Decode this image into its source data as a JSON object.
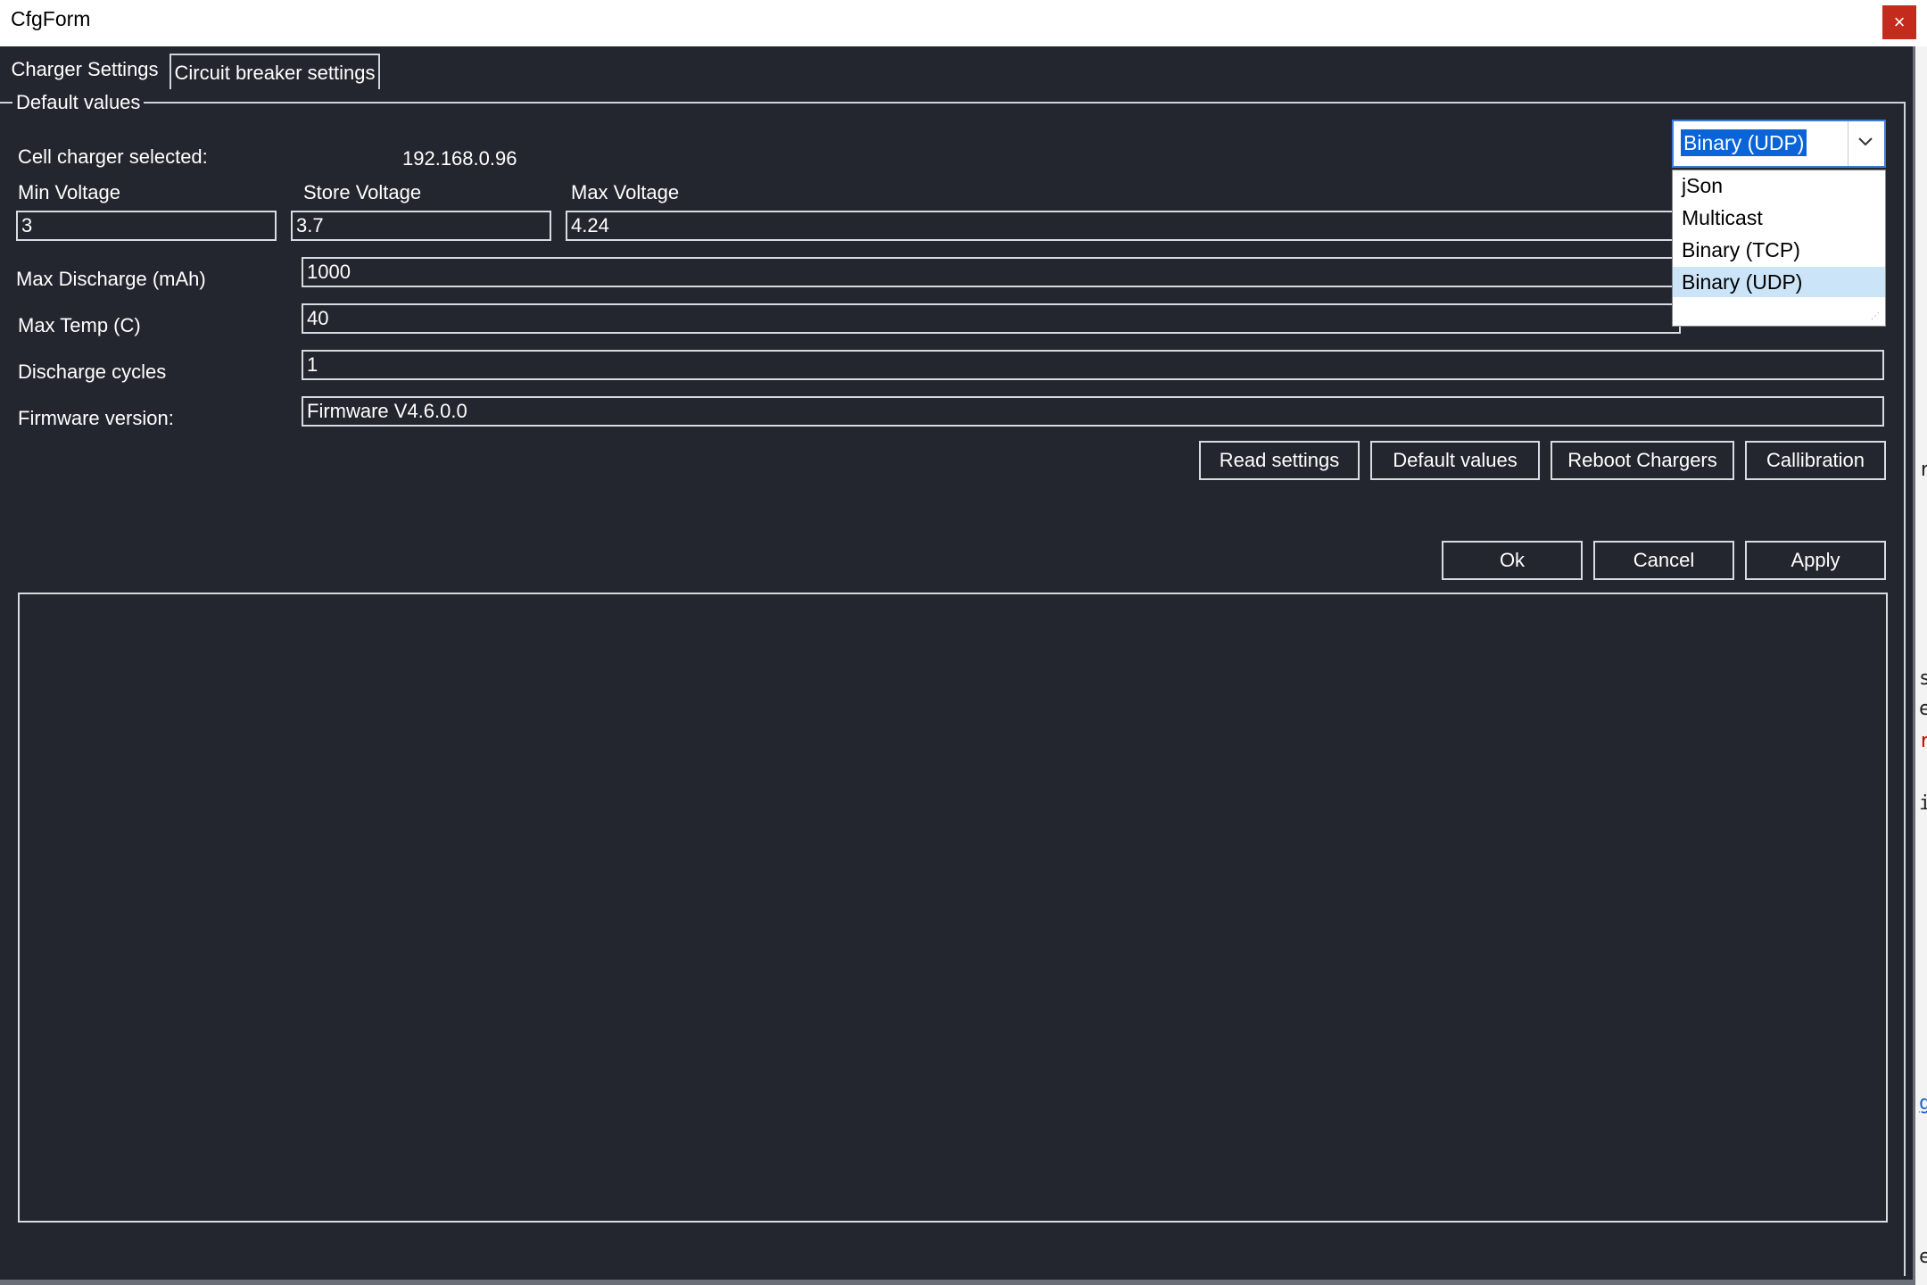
{
  "window": {
    "title": "CfgForm",
    "close_glyph": "×"
  },
  "tabs": [
    {
      "label": "Charger Settings",
      "active": true
    },
    {
      "label": "Circuit breaker settings",
      "active": false
    }
  ],
  "group": {
    "title": "Default values"
  },
  "charger": {
    "selected_label": "Cell charger selected:",
    "selected_value": "192.168.0.96"
  },
  "voltages": {
    "min_label": "Min Voltage",
    "min_value": "3",
    "store_label": "Store Voltage",
    "store_value": "3.7",
    "max_label": "Max Voltage",
    "max_value": "4.24"
  },
  "fields": {
    "max_discharge_label": "Max Discharge (mAh)",
    "max_discharge_value": "1000",
    "max_temp_label": "Max Temp (C)",
    "max_temp_value": "40",
    "cycles_label": "Discharge cycles",
    "cycles_value": "1",
    "firmware_label": "Firmware version:",
    "firmware_value": "Firmware V4.6.0.0"
  },
  "protocol": {
    "selected": "Binary (UDP)",
    "options": [
      "jSon",
      "Multicast",
      "Binary (TCP)",
      "Binary (UDP)"
    ],
    "highlight_index": 3
  },
  "actions": {
    "read": "Read settings",
    "defaults": "Default values",
    "reboot": "Reboot Chargers",
    "calibration": "Callibration"
  },
  "dialog": {
    "ok": "Ok",
    "cancel": "Cancel",
    "apply": "Apply"
  },
  "background_glyphs": [
    "r",
    "s",
    "e",
    "r",
    "i",
    "g",
    "e"
  ],
  "colors": {
    "window_bg": "#23262e",
    "highlight": "#0a64d8",
    "list_selected": "#cce4f7",
    "close": "#c42b1c"
  }
}
